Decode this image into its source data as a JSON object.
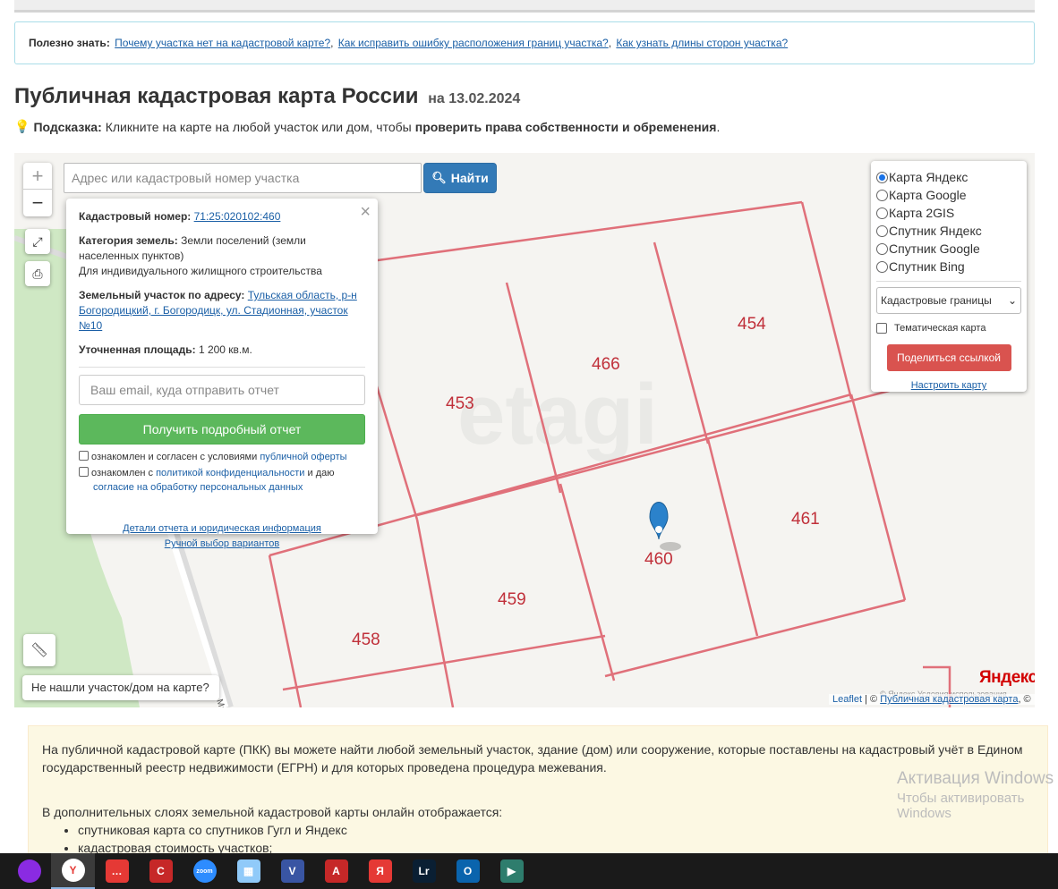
{
  "useful": {
    "label": "Полезно знать:",
    "links": [
      "Почему участка нет на кадастровой карте?",
      "Как исправить ошибку расположения границ участка?",
      "Как узнать длины сторон участка?"
    ]
  },
  "page": {
    "title": "Публичная кадастровая карта России",
    "date": "на 13.02.2024"
  },
  "hint": {
    "label": "Подсказка:",
    "text": "Кликните на карте на любой участок или дом, чтобы",
    "bold": "проверить права собственности и обременения",
    "end": "."
  },
  "search": {
    "placeholder": "Адрес или кадастровый номер участка",
    "button": "Найти"
  },
  "zoom": {
    "plus": "+",
    "minus": "−"
  },
  "popup": {
    "cadastral_label": "Кадастровый номер:",
    "cadastral_value": "71:25:020102:460",
    "category_label": "Категория земель:",
    "category_value": "Земли поселений (земли населенных пунктов)",
    "category_purpose": "Для индивидуального жилищного строительства",
    "address_label": "Земельный участок по адресу:",
    "address_value": "Тульская область, р-н Богородицкий, г. Богородицк, ул. Стадионная, участок №10",
    "area_label": "Уточненная площадь:",
    "area_value": "1 200 кв.м.",
    "email_placeholder": "Ваш email, куда отправить отчет",
    "report_button": "Получить подробный отчет",
    "check1_text": "ознакомлен и согласен с условиями",
    "check1_link": "публичной оферты",
    "check2_text": "ознакомлен с",
    "check2_link": "политикой конфиденциальности",
    "check2_mid": "и даю",
    "check2_link2": "согласие на обработку персональных данных",
    "details_link": "Детали отчета и юридическая информация",
    "manual_link": "Ручной выбор вариантов"
  },
  "layers": {
    "options": [
      "Карта Яндекс",
      "Карта Google",
      "Карта 2GIS",
      "Спутник Яндекс",
      "Спутник Google",
      "Спутник Bing"
    ],
    "selected_index": 0,
    "overlay_select": "Кадастровые границы",
    "thematic_label": "Тематическая карта",
    "share_button": "Поделиться ссылкой",
    "setup_link": "Настроить карту"
  },
  "map": {
    "parcels": [
      "453",
      "466",
      "454",
      "461",
      "460",
      "459",
      "458"
    ],
    "watermark": "etagi",
    "street": "Май",
    "not_found": "Не нашли участок/дом на карте?",
    "yandex_logo": "Яндекс",
    "yandex_terms": "© Яндекс Условия использования",
    "attribution_leaflet": "Leaflet",
    "attribution_sep": "| ©",
    "attribution_link": "Публичная кадастровая карта",
    "attribution_end": ", ©"
  },
  "info": {
    "paragraph": "На публичной кадастровой карте (ПКК) вы можете найти любой земельный участок, здание (дом) или сооружение, которые поставлены на кадастровый учёт в Едином государственный реестр недвижимости (ЕГРН) и для которых проведена процедура межевания.",
    "layers_title": "В дополнительных слоях земельной кадастровой карты онлайн отображается:",
    "items": [
      "спутниковая карта со спутников Гугл и Яндекс",
      "кадастровая стоимость участков;"
    ]
  },
  "windows": {
    "line1": "Активация Windows",
    "line2": "Чтобы активировать Windows"
  },
  "taskbar": {
    "apps": [
      {
        "name": "app-purple-circle",
        "label": "",
        "color": "#8a2be2"
      },
      {
        "name": "yandex-browser",
        "label": "Y",
        "color": "#ffffff"
      },
      {
        "name": "chat-app",
        "label": "…",
        "color": "#e53935"
      },
      {
        "name": "red-c-app",
        "label": "C",
        "color": "#c62828"
      },
      {
        "name": "zoom",
        "label": "zoom",
        "color": "#2d8cff"
      },
      {
        "name": "calculator",
        "label": "▦",
        "color": "#90caf9"
      },
      {
        "name": "visio",
        "label": "V",
        "color": "#3955a3"
      },
      {
        "name": "acrobat",
        "label": "A",
        "color": "#c62828"
      },
      {
        "name": "yandex-app",
        "label": "Я",
        "color": "#e53935"
      },
      {
        "name": "lightroom",
        "label": "Lr",
        "color": "#0a1f33"
      },
      {
        "name": "outlook",
        "label": "O",
        "color": "#0a64ad"
      },
      {
        "name": "media-app",
        "label": "▶",
        "color": "#2e7d6d"
      }
    ]
  }
}
